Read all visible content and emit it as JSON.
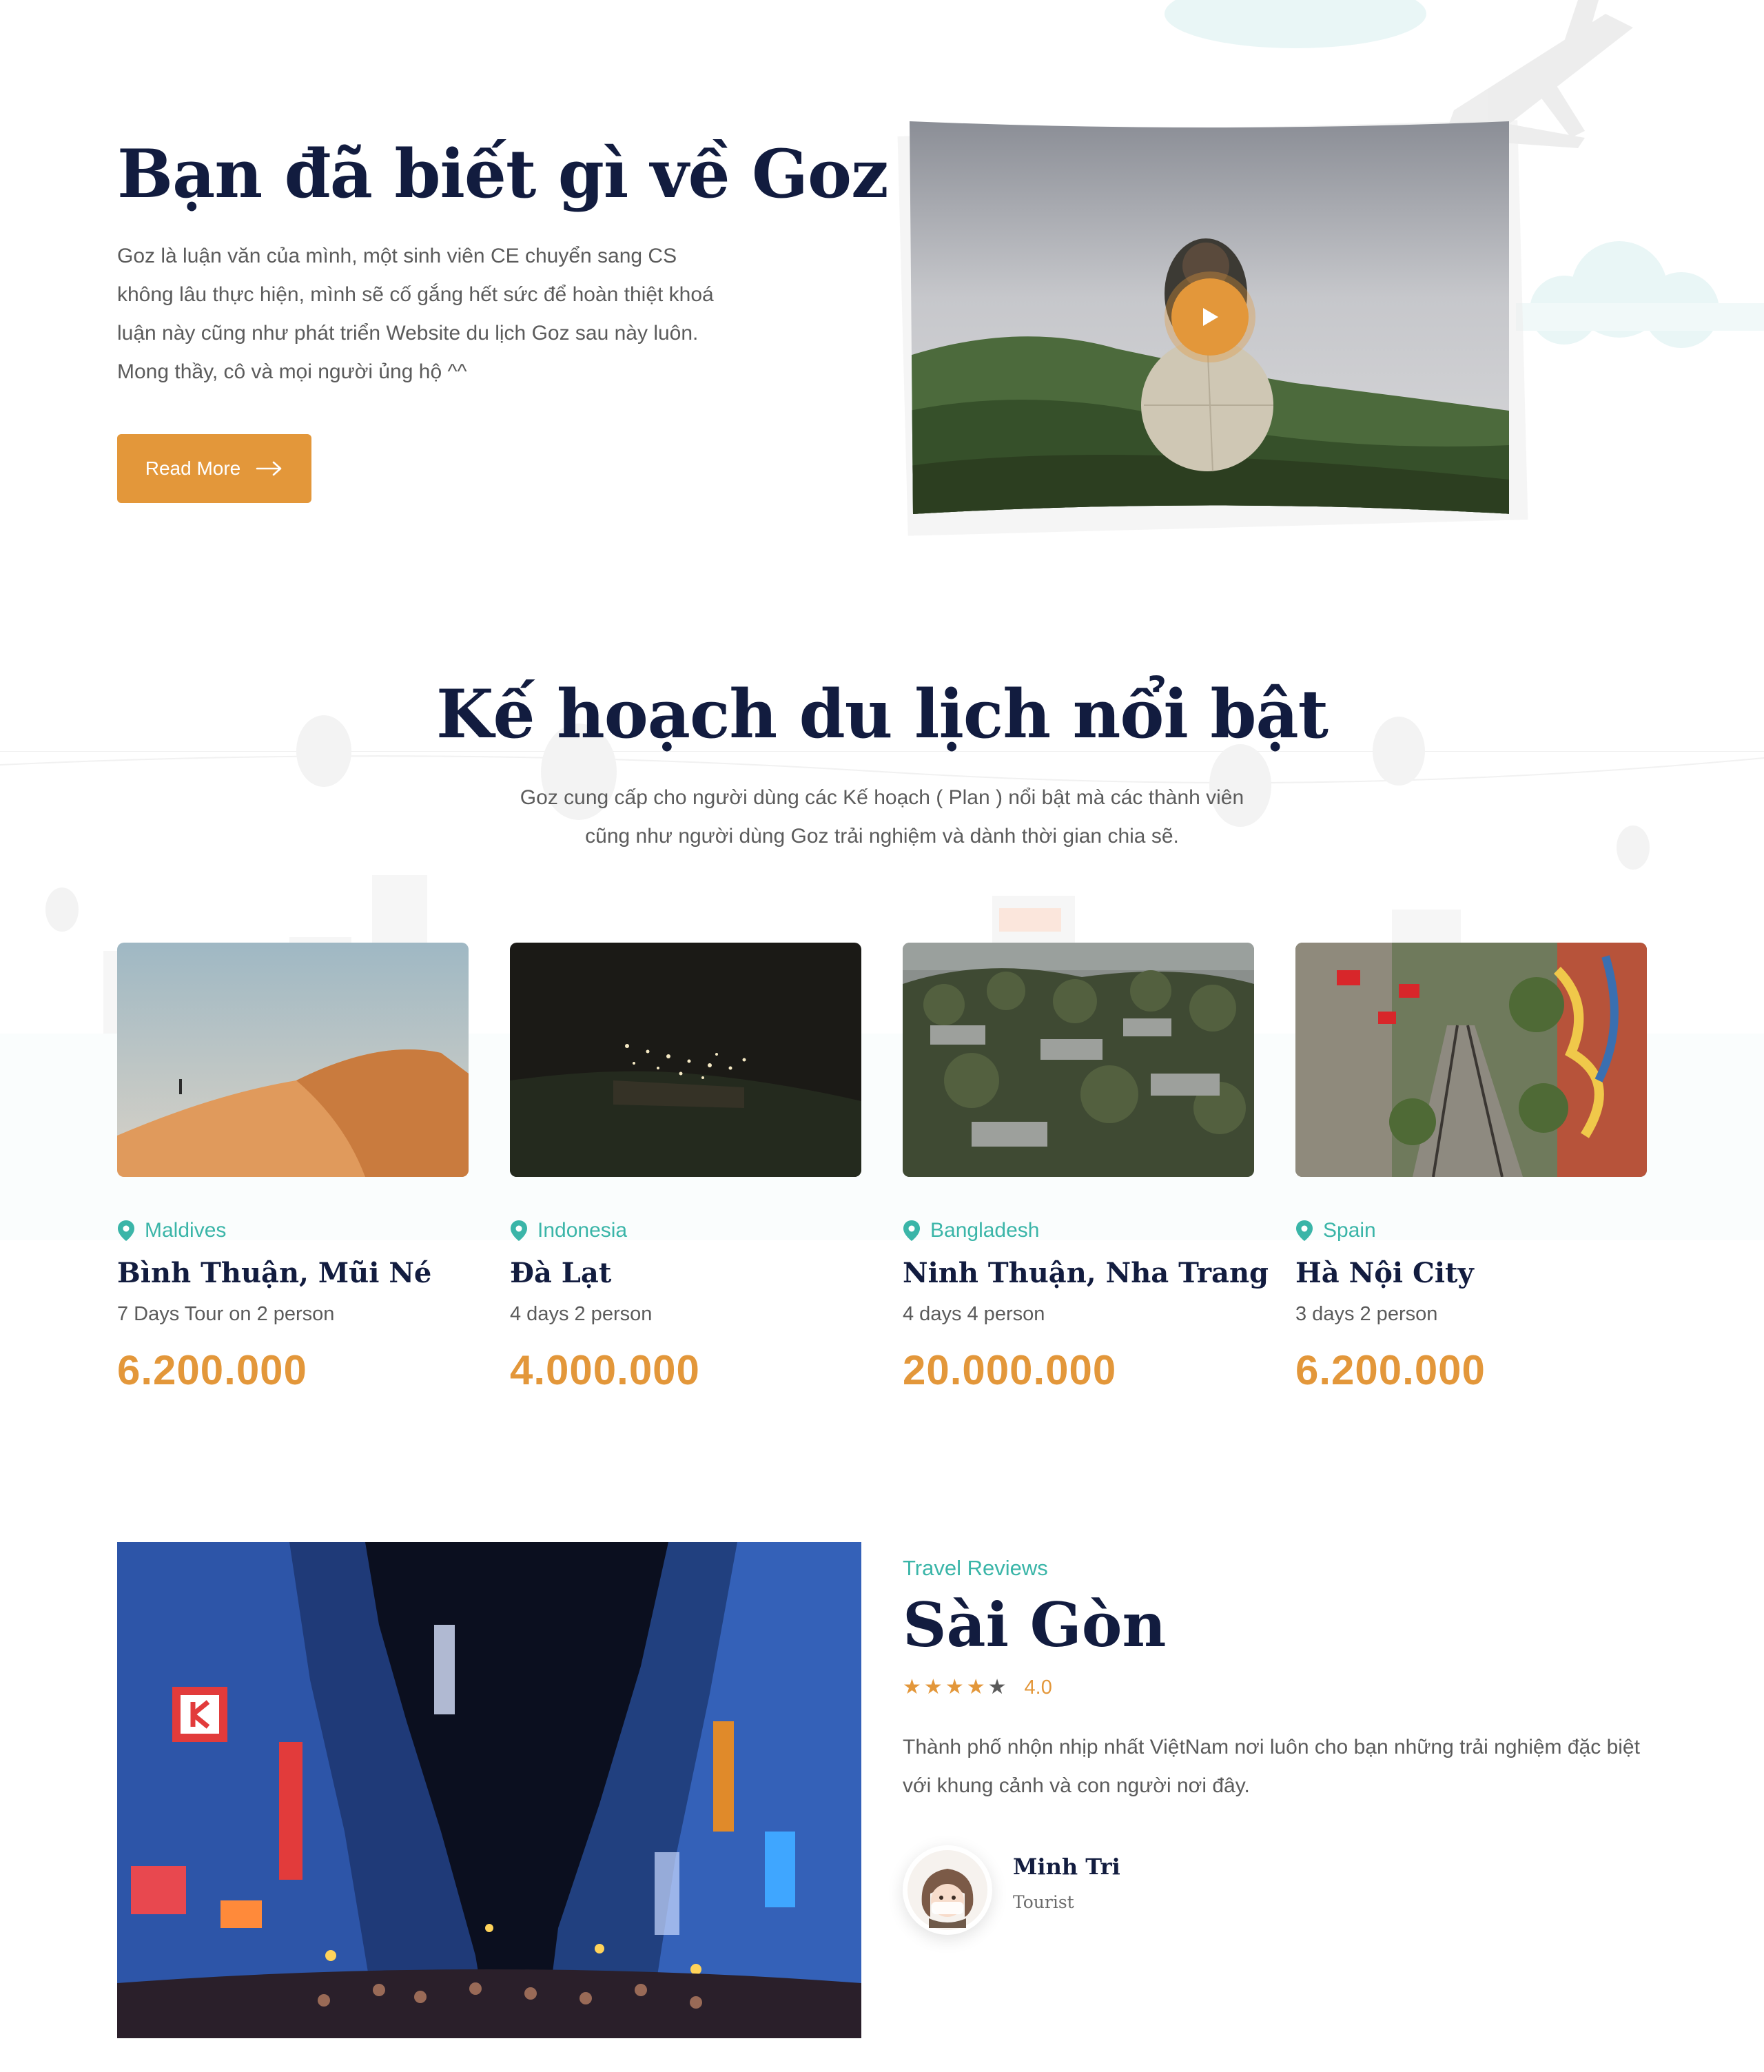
{
  "about": {
    "title": "Bạn đã biết gì về Goz",
    "text": "Goz là luận văn của mình, một sinh viên CE chuyển sang CS không lâu thực hiện, mình sẽ cố gắng hết sức để hoàn thiệt khoá luận này cũng như phát triển Website du lịch Goz sau này luôn. Mong thầy, cô và mọi người ủng hộ ^^",
    "button_label": "Read More",
    "play_icon": "play-icon",
    "arrow_icon": "arrow-right-icon"
  },
  "plans": {
    "title": "Kế hoạch du lịch nổi bật",
    "subtitle": "Goz cung cấp cho người dùng các Kế hoạch ( Plan ) nổi bật mà các thành viên cũng như người dùng Goz trải nghiệm và dành thời gian chia sẽ.",
    "location_icon": "map-pin-icon",
    "cards": [
      {
        "location": "Maldives",
        "title": "Bình Thuận, Mũi Né",
        "meta": "7 Days Tour on 2 person",
        "price": "6.200.000"
      },
      {
        "location": "Indonesia",
        "title": "Đà Lạt",
        "meta": "4 days 2 person",
        "price": "4.000.000"
      },
      {
        "location": "Bangladesh",
        "title": "Ninh Thuận, Nha Trang",
        "meta": "4 days 4 person",
        "price": "20.000.000"
      },
      {
        "location": "Spain",
        "title": "Hà Nội City",
        "meta": "3 days 2 person",
        "price": "6.200.000"
      }
    ]
  },
  "review": {
    "tag": "Travel Reviews",
    "city": "Sài Gòn",
    "rating": 4.0,
    "rating_label": "4.0",
    "text": "Thành phố nhộn nhịp nhất ViệtNam nơi luôn cho bạn những trải nghiệm đặc biệt với khung cảnh và con người nơi đây.",
    "author": {
      "name": "Minh Tri",
      "role": "Tourist"
    }
  },
  "colors": {
    "navy": "#121c3f",
    "accent": "#e3973a",
    "teal": "#3ab5a8",
    "body_text": "#5b5b5b"
  }
}
